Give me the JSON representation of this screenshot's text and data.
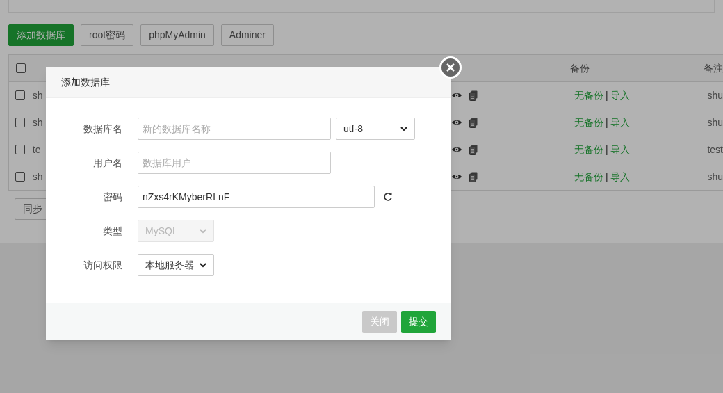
{
  "toolbar": [
    {
      "label": "添加数据库",
      "kind": "primary"
    },
    {
      "label": "root密码",
      "kind": "default"
    },
    {
      "label": "phpMyAdmin",
      "kind": "default"
    },
    {
      "label": "Adminer",
      "kind": "default"
    }
  ],
  "table": {
    "header_checked": false,
    "columns": [
      "备份",
      "备注"
    ],
    "rows": [
      {
        "name": "sh",
        "checked": false,
        "backup": "无备份",
        "separator": "|",
        "import": "导入",
        "remark": "shu"
      },
      {
        "name": "sh",
        "checked": false,
        "backup": "无备份",
        "separator": "|",
        "import": "导入",
        "remark": "shu"
      },
      {
        "name": "te",
        "checked": false,
        "backup": "无备份",
        "separator": "|",
        "import": "导入",
        "remark": "test"
      },
      {
        "name": "sh",
        "checked": false,
        "backup": "无备份",
        "separator": "|",
        "import": "导入",
        "remark": "shu"
      }
    ]
  },
  "sync_button": "同步",
  "dialog": {
    "title": "添加数据库",
    "fields": [
      {
        "kind": "text_select",
        "label": "数据库名",
        "placeholder": "新的数据库名称",
        "select": "utf-8"
      },
      {
        "kind": "text",
        "label": "用户名",
        "placeholder": "数据库用户"
      },
      {
        "kind": "password",
        "label": "密码",
        "value": "nZxs4rKMyberRLnF"
      },
      {
        "kind": "select",
        "label": "类型",
        "select": "MySQL",
        "disabled": true
      },
      {
        "kind": "select",
        "label": "访问权限",
        "select": "本地服务器",
        "disabled": false
      }
    ],
    "buttons": [
      {
        "label": "关闭",
        "kind": "secondary"
      },
      {
        "label": "提交",
        "kind": "primary"
      }
    ]
  }
}
